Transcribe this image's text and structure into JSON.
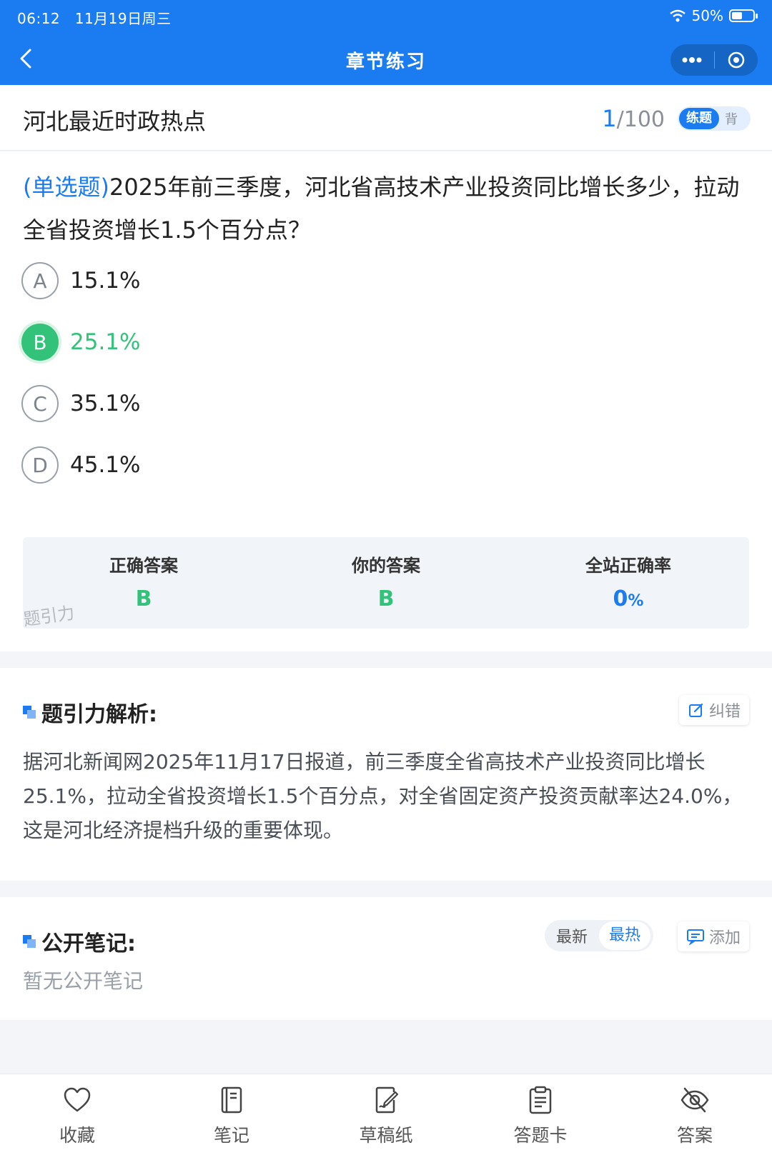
{
  "status_bar": {
    "time": "06:12",
    "date": "11月19日周三",
    "battery": "50%"
  },
  "nav": {
    "title": "章节练习"
  },
  "question_bar": {
    "chapter": "河北最近时政热点",
    "current": "1",
    "total": "/100",
    "mode_active": "练题",
    "mode_inactive": "背"
  },
  "question": {
    "type": "(单选题)",
    "text": "2025年前三季度，河北省高技术产业投资同比增长多少，拉动全省投资增长1.5个百分点？",
    "options": [
      {
        "letter": "A",
        "text": "15.1%"
      },
      {
        "letter": "B",
        "text": "25.1%",
        "selected": true
      },
      {
        "letter": "C",
        "text": "35.1%"
      },
      {
        "letter": "D",
        "text": "45.1%"
      }
    ]
  },
  "result": {
    "correct_label": "正确答案",
    "correct_value": "B",
    "yours_label": "你的答案",
    "yours_value": "B",
    "rate_label": "全站正确率",
    "rate_value": "0",
    "rate_unit": "%"
  },
  "watermark": "题引力",
  "analysis": {
    "title": "题引力解析:",
    "report_button": "纠错",
    "body": "据河北新闻网2025年11月17日报道，前三季度全省高技术产业投资同比增长25.1%，拉动全省投资增长1.5个百分点，对全省固定资产投资贡献率达24.0%，这是河北经济提档升级的重要体现。"
  },
  "notes": {
    "title": "公开笔记:",
    "sort_newest": "最新",
    "sort_hottest": "最热",
    "add_button": "添加",
    "empty_text": "暂无公开笔记"
  },
  "tabs": [
    {
      "label": "收藏",
      "icon": "heart-icon"
    },
    {
      "label": "笔记",
      "icon": "notebook-icon"
    },
    {
      "label": "草稿纸",
      "icon": "draft-icon"
    },
    {
      "label": "答题卡",
      "icon": "clipboard-icon"
    },
    {
      "label": "答案",
      "icon": "eye-off-icon"
    }
  ],
  "colors": {
    "primary": "#1a7cf0",
    "correct": "#33c27a"
  }
}
